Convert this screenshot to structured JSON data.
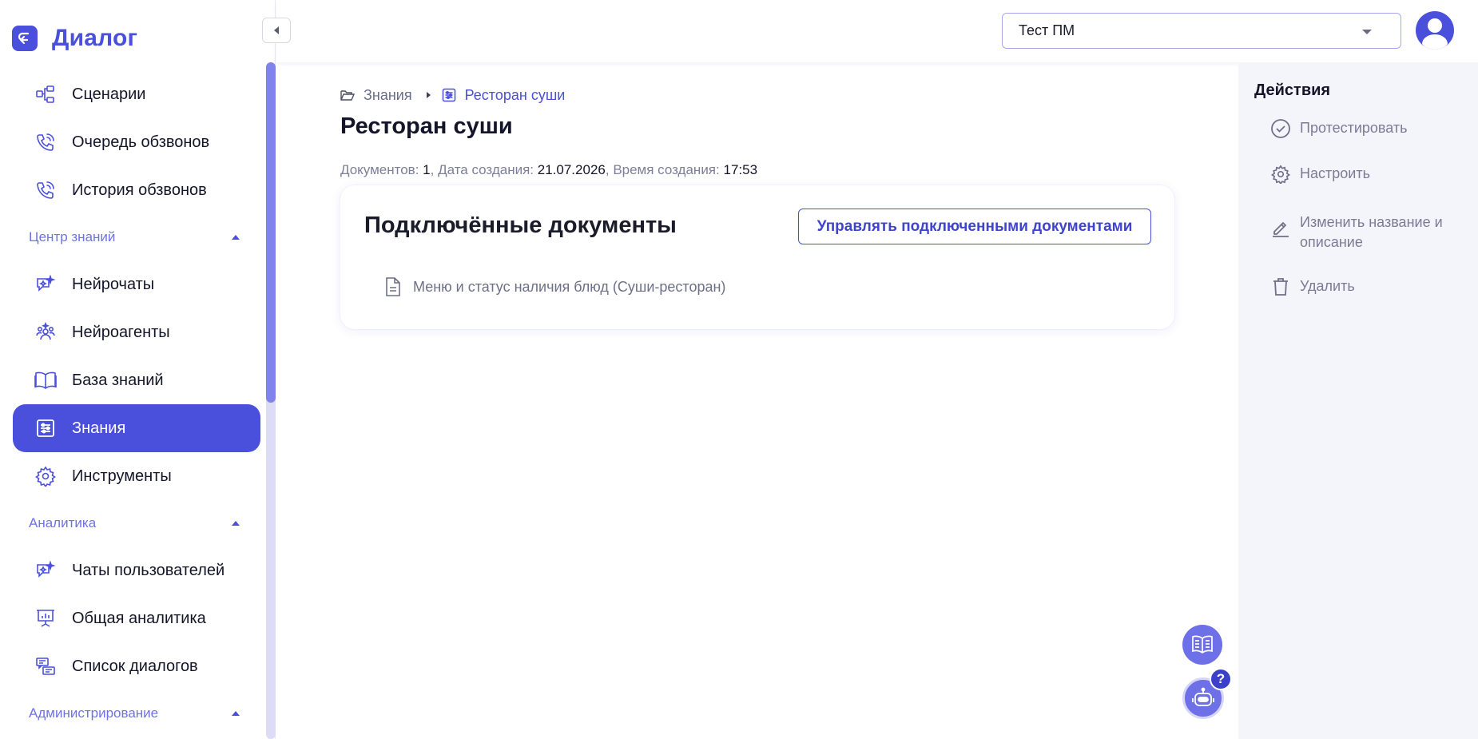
{
  "app": {
    "brand": "Диалог",
    "colors": {
      "accent": "#4a4fdc",
      "section": "#6e72e6",
      "panel": "#f4f4fb"
    }
  },
  "sidebar": {
    "items_top": [
      {
        "label": "Сценарии",
        "icon": "scenarios-icon"
      },
      {
        "label": "Очередь обзвонов",
        "icon": "phone-icon"
      },
      {
        "label": "История обзвонов",
        "icon": "phone-icon"
      }
    ],
    "sections": [
      {
        "label": "Центр знаний",
        "items": [
          {
            "label": "Нейрочаты",
            "icon": "sparkle-chat-icon"
          },
          {
            "label": "Нейроагенты",
            "icon": "agents-icon"
          },
          {
            "label": "База знаний",
            "icon": "book-icon"
          },
          {
            "label": "Знания",
            "icon": "sliders-doc-icon",
            "active": true
          },
          {
            "label": "Инструменты",
            "icon": "gear-icon"
          }
        ]
      },
      {
        "label": "Аналитика",
        "items": [
          {
            "label": "Чаты пользователей",
            "icon": "sparkle-chat-icon"
          },
          {
            "label": "Общая аналитика",
            "icon": "chart-board-icon"
          },
          {
            "label": "Список диалогов",
            "icon": "dialog-list-icon"
          }
        ]
      },
      {
        "label": "Администрирование",
        "items": []
      }
    ]
  },
  "topbar": {
    "project_select": {
      "value": "Тест ПМ"
    }
  },
  "breadcrumb": {
    "parent": "Знания",
    "current": "Ресторан суши"
  },
  "page": {
    "title": "Ресторан суши",
    "meta": {
      "docs_label": "Документов:",
      "docs_value": "1",
      "created_date_label": "Дата создания:",
      "created_date_value": "21.07.2026",
      "created_time_label": "Время создания:",
      "created_time_value": "17:53"
    }
  },
  "card": {
    "title": "Подключённые документы",
    "manage_button": "Управлять подключенными документами",
    "documents": [
      {
        "name": "Меню и статус наличия блюд (Суши-ресторан)"
      }
    ]
  },
  "actions": {
    "title": "Действия",
    "items": [
      {
        "label": "Протестировать",
        "icon": "check-circle-icon"
      },
      {
        "label": "Настроить",
        "icon": "gear-icon"
      },
      {
        "label": "Изменить название и описание",
        "icon": "pencil-icon"
      },
      {
        "label": "Удалить",
        "icon": "trash-icon"
      }
    ]
  },
  "floating": {
    "help_badge": "?"
  }
}
